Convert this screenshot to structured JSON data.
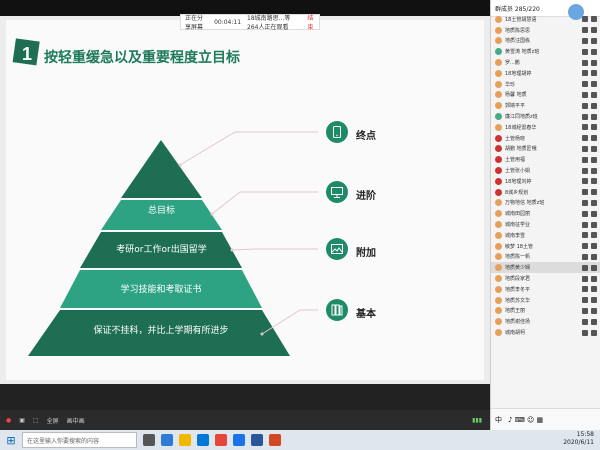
{
  "meeting": {
    "share_status": "正在分享屏幕",
    "share_time": "00:04:11",
    "share_viewers": "18城南路思...等264人正在观看",
    "stop_label": "结束"
  },
  "slide": {
    "badge_number": "1",
    "title": "按轻重缓急以及重要程度立目标",
    "tiers": [
      {
        "label": "总目标"
      },
      {
        "label": "考研or工作or出国留学"
      },
      {
        "label": "学习技能和考取证书"
      },
      {
        "label": "保证不挂科，并比上学期有所进步"
      }
    ],
    "steps": [
      {
        "label": "终点",
        "icon": "phone-icon"
      },
      {
        "label": "进阶",
        "icon": "monitor-icon"
      },
      {
        "label": "附加",
        "icon": "image-icon"
      },
      {
        "label": "基本",
        "icon": "books-icon"
      }
    ],
    "colors": {
      "dark_green": "#1e6e53",
      "mid_green": "#2ea383",
      "title_green": "#1e7a5c"
    }
  },
  "sidebar": {
    "header": "群成员 285/220",
    "members": [
      "18土管胡慧语",
      "地质陈思思",
      "地质汪国栋",
      "黄雪涛 地质z班",
      "罗...鹏",
      "18地理胡婷",
      "华珍",
      "杨馨 地质",
      "郭婧平平",
      "廉江同地质z班",
      "18城经雷春华",
      "土管杨晓",
      "胡鹏 地质匠哦",
      "土管用福",
      "土管张小娟",
      "18地理刘婷",
      "8城乡规划",
      "万物地信 地质z班",
      "城南田园丽",
      "城南征学业",
      "城南李雪",
      "敏梦 18土管",
      "地质陈一帆",
      "地质黄少娴",
      "地质段家君",
      "地质李冬平",
      "地质苏文华",
      "地质王丽",
      "地质谢佳扬",
      "城南胡柯"
    ],
    "selected_index": 23
  },
  "controls": {
    "items": [
      "全屏",
      "画中画"
    ]
  },
  "taskbar": {
    "search_placeholder": "在这里输入你要搜索的内容",
    "time": "15:58",
    "date": "2020/6/11",
    "lang": "中"
  }
}
